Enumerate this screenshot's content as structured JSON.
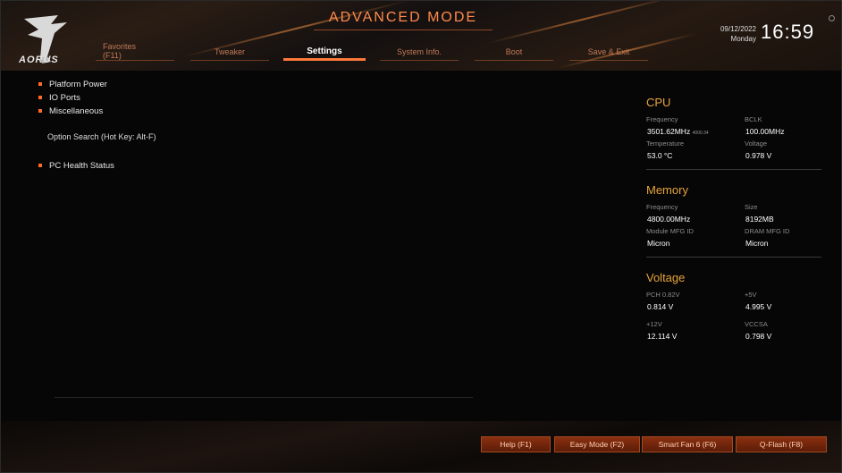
{
  "header": {
    "mode_title": "ADVANCED MODE",
    "brand": "AORUS",
    "date": "09/12/2022",
    "day": "Monday",
    "time": "16:59"
  },
  "tabs": [
    {
      "line1": "Favorites",
      "line2": "(F11)"
    },
    {
      "label": "Tweaker"
    },
    {
      "label": "Settings",
      "active": true
    },
    {
      "label": "System Info."
    },
    {
      "label": "Boot"
    },
    {
      "label": "Save & Exit"
    }
  ],
  "menu": {
    "items": [
      "Platform Power",
      "IO Ports",
      "Miscellaneous"
    ],
    "option_search": "Option Search (Hot Key: Alt-F)",
    "health": "PC Health Status"
  },
  "cpu": {
    "title": "CPU",
    "freq_label": "Frequency",
    "bclk_label": "BCLK",
    "freq_value": "3501.62MHz",
    "freq_small": "4000.34",
    "bclk_value": "100.00MHz",
    "temp_label": "Temperature",
    "volt_label": "Voltage",
    "temp_value": "53.0 °C",
    "volt_value": "0.978 V"
  },
  "memory": {
    "title": "Memory",
    "freq_label": "Frequency",
    "size_label": "Size",
    "freq_value": "4800.00MHz",
    "size_value": "8192MB",
    "mfg_label": "Module MFG ID",
    "dram_label": "DRAM MFG ID",
    "mfg_value": "Micron",
    "dram_value": "Micron"
  },
  "voltage": {
    "title": "Voltage",
    "pch_label": "PCH 0.82V",
    "v5_label": "+5V",
    "pch_value": "0.814 V",
    "v5_value": "4.995 V",
    "v12_label": "+12V",
    "vccsa_label": "VCCSA",
    "v12_value": "12.114 V",
    "vccsa_value": "0.798 V"
  },
  "footer": {
    "help": "Help (F1)",
    "easy_mode": "Easy Mode (F2)",
    "smart_fan": "Smart Fan 6 (F6)",
    "qflash": "Q-Flash (F8)"
  },
  "colors": {
    "accent": "#ff7a3a",
    "section_title": "#e8a43a",
    "button_bg": "#8a2f10"
  }
}
